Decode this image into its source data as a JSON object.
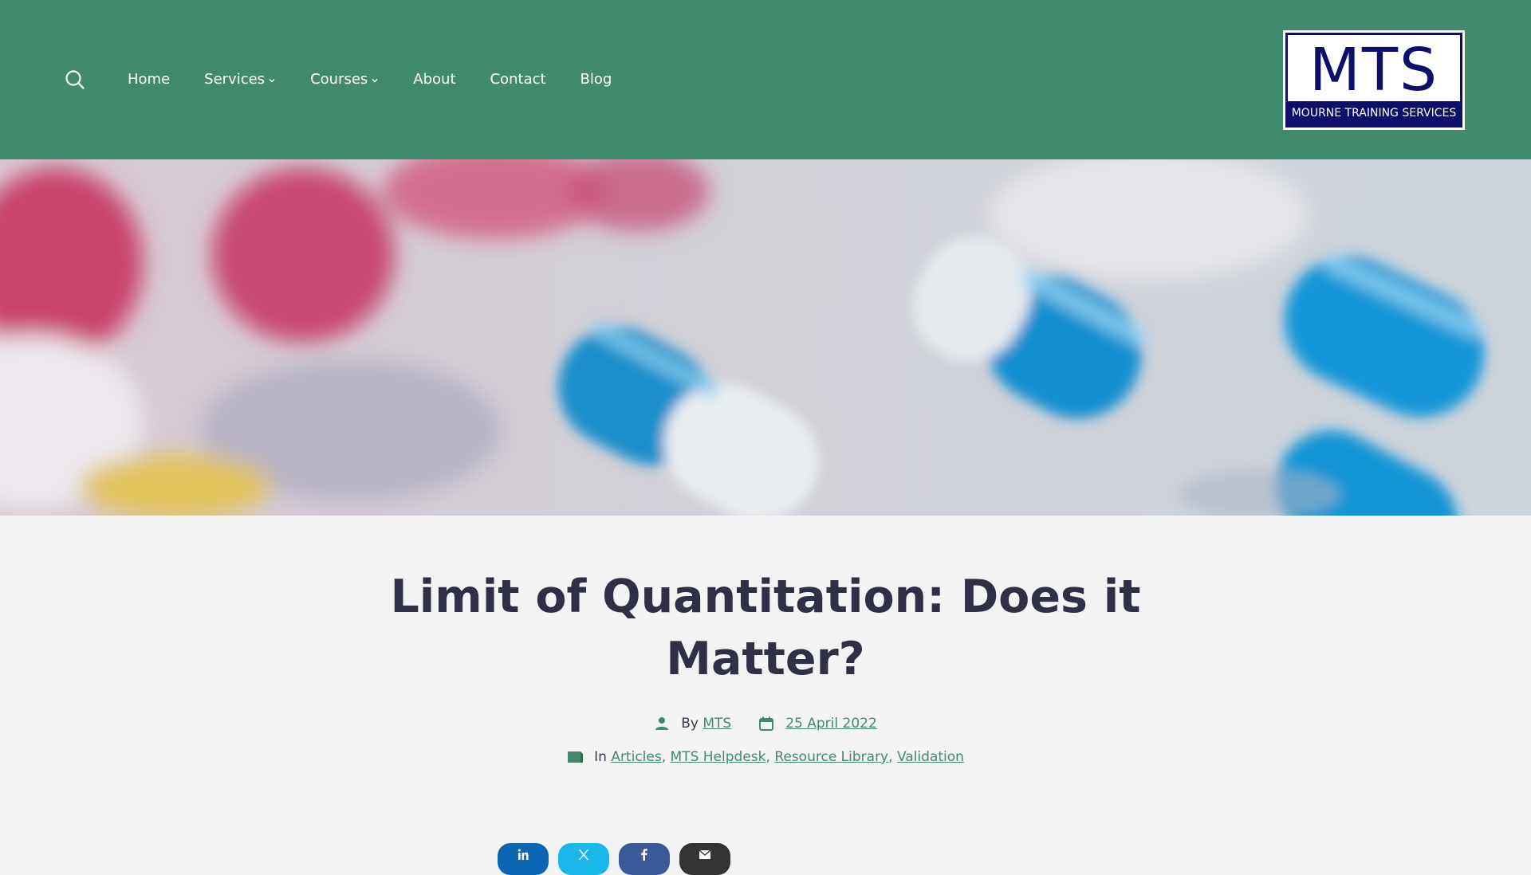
{
  "header": {
    "background": "#408b6e",
    "search_icon": "search-icon",
    "nav": [
      {
        "label": "Home"
      },
      {
        "label": "Services"
      },
      {
        "label": "Courses"
      },
      {
        "label": "About"
      },
      {
        "label": "Contact"
      },
      {
        "label": "Blog"
      }
    ],
    "logo": {
      "mark": "MTS",
      "subtitle": "MOURNE TRAINING SERVICES",
      "color": "#0e0e6b"
    }
  },
  "hero": {
    "icon": "capsules-photo"
  },
  "article": {
    "title": "Limit of Quantitation: Does it Matter?",
    "by_prefix": "By",
    "author": "MTS",
    "date": "25 April 2022",
    "in_prefix": "In",
    "categories": [
      "Articles",
      "MTS Helpdesk",
      "Resource Library",
      "Validation"
    ],
    "link_color": "#408b6e"
  },
  "share": [
    {
      "icon": "linkedin-icon",
      "color": "#0a66b2"
    },
    {
      "icon": "x-twitter-icon",
      "color": "#1ab7ea"
    },
    {
      "icon": "facebook-icon",
      "color": "#3b5998"
    },
    {
      "icon": "email-icon",
      "color": "#333333"
    }
  ]
}
